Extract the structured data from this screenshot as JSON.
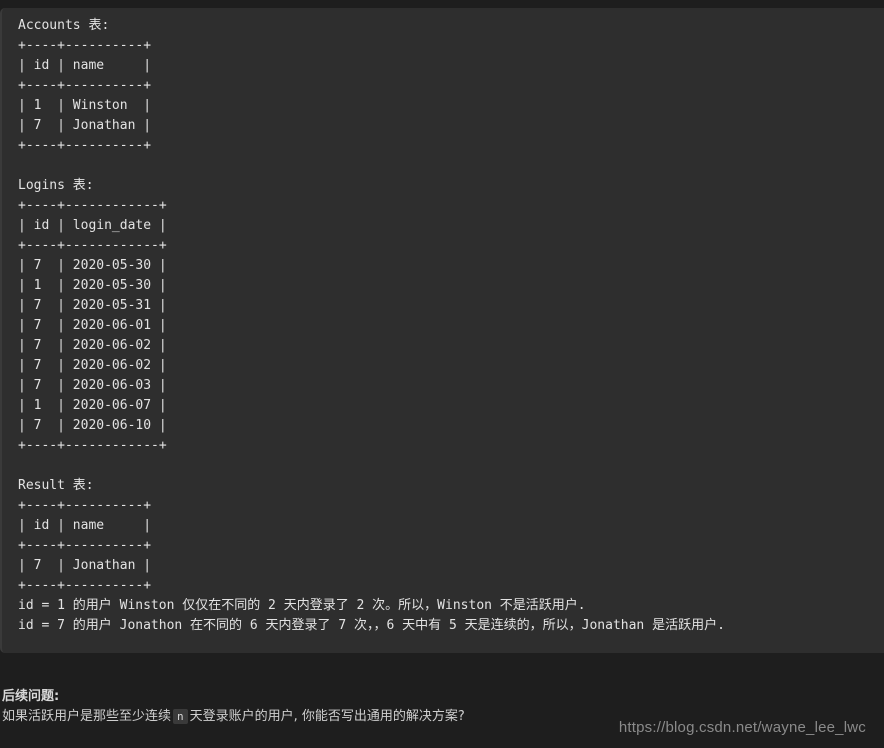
{
  "code_block": {
    "lines": [
      "Accounts 表:",
      "+----+----------+",
      "| id | name     |",
      "+----+----------+",
      "| 1  | Winston  |",
      "| 7  | Jonathan |",
      "+----+----------+",
      "",
      "Logins 表:",
      "+----+------------+",
      "| id | login_date |",
      "+----+------------+",
      "| 7  | 2020-05-30 |",
      "| 1  | 2020-05-30 |",
      "| 7  | 2020-05-31 |",
      "| 7  | 2020-06-01 |",
      "| 7  | 2020-06-02 |",
      "| 7  | 2020-06-02 |",
      "| 7  | 2020-06-03 |",
      "| 1  | 2020-06-07 |",
      "| 7  | 2020-06-10 |",
      "+----+------------+",
      "",
      "Result 表:",
      "+----+----------+",
      "| id | name     |",
      "+----+----------+",
      "| 7  | Jonathan |",
      "+----+----------+",
      "id = 1 的用户 Winston 仅仅在不同的 2 天内登录了 2 次。所以，Winston 不是活跃用户.",
      "id = 7 的用户 Jonathon 在不同的 6 天内登录了 7 次，，6 天中有 5 天是连续的，所以，Jonathan 是活跃用户."
    ]
  },
  "followup": {
    "heading": "后续问题:",
    "body_before": "如果活跃用户是那些至少连续",
    "code_token": "n",
    "body_after": "天登录账户的用户, 你能否写出通用的解决方案?"
  },
  "watermark": {
    "url": "https://blog.csdn.net/wayne_lee_lwc"
  },
  "theme": {
    "page_background": "#1e1e1e",
    "code_background": "#2e2e2e",
    "code_text": "#e3e3e3",
    "inline_code_background": "#3a3a3a",
    "watermark_color": "#8a8a8a"
  }
}
